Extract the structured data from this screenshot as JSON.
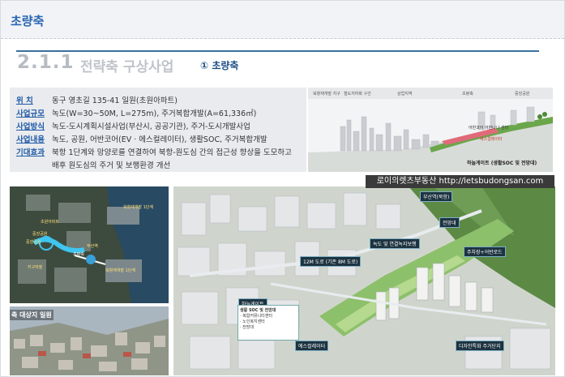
{
  "header": {
    "title": "초량축"
  },
  "section": {
    "number": "2.1.1",
    "title": "전략축 구상사업",
    "subtitle": "① 초량축"
  },
  "info": [
    {
      "key": "위 치",
      "value": "동구 영초길 135-41 일원(초원아파트)"
    },
    {
      "key": "사업규모",
      "value": "녹도(W=30~50M, L=275m), 주거복합개발(A=61,336㎡)"
    },
    {
      "key": "사업방식",
      "value": "녹도-도시계획시설사업(부산시, 공공기관), 주거-도시개발사업"
    },
    {
      "key": "사업내용",
      "value": "녹도, 공원, 어반코어(EV · 에스컬레이터), 생활SOC, 주거복합개발"
    },
    {
      "key": "기대효과",
      "value": "북항 1단계와 망양로를 연결하여 북항-원도심 간의 접근성 향상을 도모하고"
    },
    {
      "key": "",
      "value": "배후 원도심의 주거 및 보행환경 개선"
    }
  ],
  "cross_section": {
    "captions": [
      "북항재개발 지구",
      "철도지하화 구간",
      "상업지역",
      "초량축",
      "중앙공원"
    ],
    "labels": [
      "어반코어 어반나나 센터",
      "에스컬레이터",
      "하늘게이트 (생활SOC 및 전망대)"
    ]
  },
  "watermark": "로이의렛츠부동산 http://letsbudongsan.com",
  "map": {
    "labels": [
      "북항재개발 1단계",
      "부산역",
      "초량축",
      "북항재개발 1단계",
      "초원아파트",
      "중앙공원",
      "중앙공원",
      "지구마을"
    ]
  },
  "bottom_photo": {
    "caption": "축 대상지 일원"
  },
  "aerial": {
    "labels": {
      "corner": "부산역(북항)",
      "observatory": "전망대",
      "greenway": "녹도 및 연결녹지보행",
      "road": "12M 도로 (기존 8M 도로)",
      "parking": "주차장+어반로드",
      "gate": "하늘게이트",
      "escalator": "에스컬레이터",
      "housing": "디자인특화 주거단지"
    },
    "legend": [
      "생활 SOC 및 전망대",
      "· 복합커뮤니티센터",
      "· 노인복지센터",
      "· 전망대"
    ]
  },
  "colors": {
    "accent": "#2a66b3",
    "rule": "#3a6fa0",
    "key": "#1f5aa6"
  }
}
